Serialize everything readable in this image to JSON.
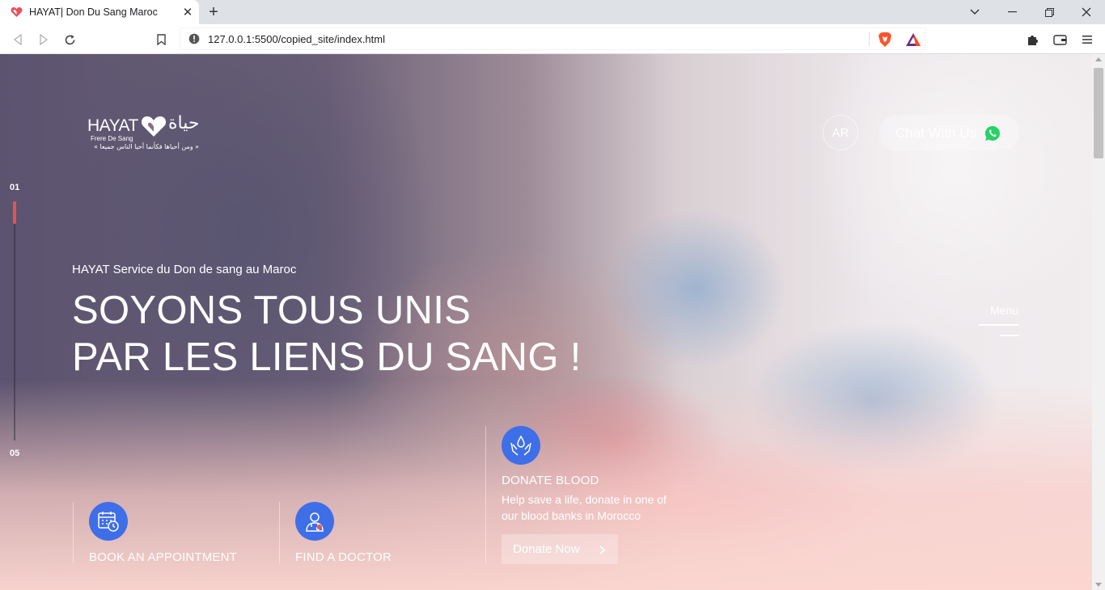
{
  "browser": {
    "tab_title": "HAYAT| Don Du Sang Maroc",
    "url": "127.0.0.1:5500/copied_site/index.html"
  },
  "site": {
    "logo": {
      "wordmark": "HAYAT",
      "arabic": "حياة",
      "subtitle": "Frere De Sang",
      "tagline": "« ومن أحياها فكأنما أحيا الناس جميعا »"
    },
    "lang_button": "AR",
    "chat_button": "Chat With Us",
    "slide_indicator": {
      "current": "01",
      "total": "05"
    },
    "hero": {
      "kicker": "HAYAT Service du Don de sang au Maroc",
      "headline_line1": "SOYONS TOUS UNIS",
      "headline_line2": "PAR LES LIENS DU SANG !"
    },
    "menu_label": "Menu",
    "features": [
      {
        "title": "BOOK AN APPOINTMENT",
        "icon": "calendar-clock-icon"
      },
      {
        "title": "FIND A DOCTOR",
        "icon": "doctor-icon"
      },
      {
        "title": "DONATE BLOOD",
        "icon": "hands-drop-icon",
        "description": "Help save a life, donate in one of our blood banks in Morocco",
        "button": "Donate Now"
      }
    ]
  },
  "colors": {
    "accent_blue": "#3f6fe8",
    "slide_red": "#e5554f",
    "whatsapp_green": "#25d366"
  }
}
